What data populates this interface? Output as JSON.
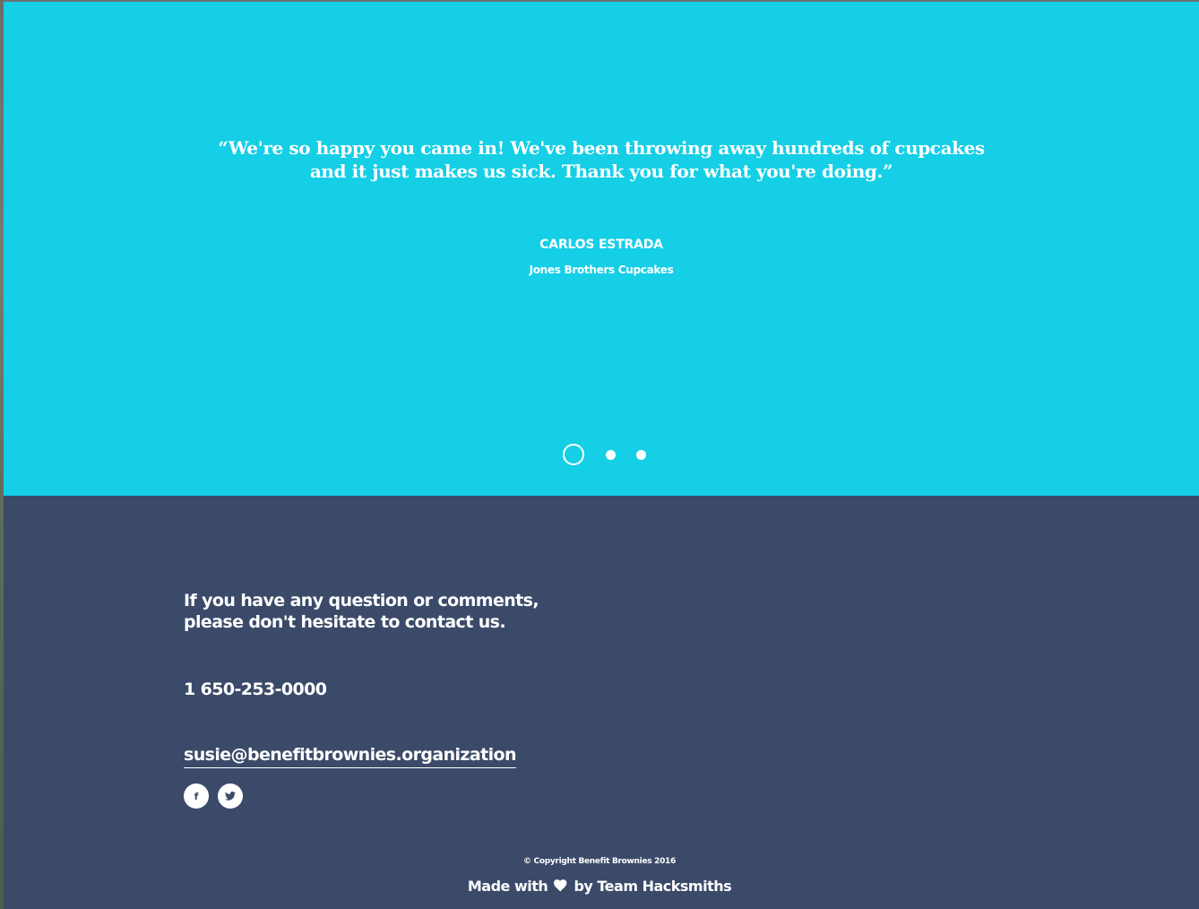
{
  "colors": {
    "testimonial_bg": "#14cfe6",
    "footer_bg": "#3b4a69",
    "text": "#ffffff"
  },
  "testimonial": {
    "quote_lines": [
      "“We're so happy you came in! We've been throwing away hundreds of cupcakes",
      "and it just makes us sick. Thank you for what you're doing.”"
    ],
    "author": "CARLOS ESTRADA",
    "company": "Jones Brothers Cupcakes",
    "carousel": {
      "total_slides": 3,
      "active_slide": 1
    }
  },
  "footer": {
    "contact_intro_lines": [
      "If you have any question or comments,",
      "please don't hesitate to contact us."
    ],
    "phone": "1 650-253-0000",
    "email": "susie@benefitbrownies.organization",
    "social": {
      "facebook_glyph": "f",
      "facebook_icon": "facebook-icon",
      "twitter_icon": "twitter-icon"
    },
    "copyright": "© Copyright Benefit Brownies 2016",
    "made_with_prefix": "Made with",
    "made_with_icon": "heart-icon",
    "made_with_suffix": "by Team Hacksmiths"
  }
}
